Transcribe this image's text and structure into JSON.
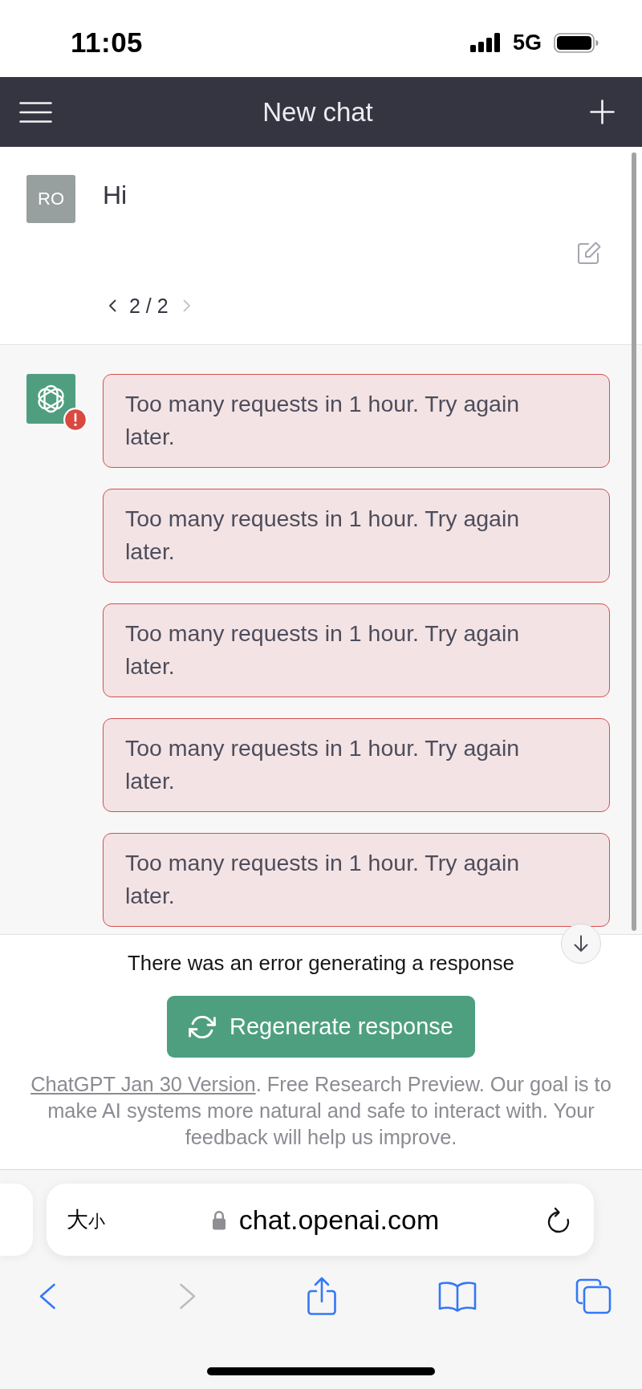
{
  "status_bar": {
    "time": "11:05",
    "network": "5G"
  },
  "header": {
    "title": "New chat"
  },
  "user_message": {
    "avatar": "RO",
    "text": "Hi",
    "pager": {
      "label": "2 / 2",
      "prev_disabled": false,
      "next_disabled": true
    }
  },
  "assistant": {
    "error": true,
    "messages": [
      {
        "text": "Too many requests in 1 hour. Try again later.",
        "error": true
      },
      {
        "text": "Too many requests in 1 hour. Try again later.",
        "error": true
      },
      {
        "text": "Too many requests in 1 hour. Try again later.",
        "error": true
      },
      {
        "text": "Too many requests in 1 hour. Try again later.",
        "error": true
      },
      {
        "text": "Too many requests in 1 hour. Try again later.",
        "error": true
      }
    ]
  },
  "error_notice": "There was an error generating a response",
  "regenerate_button": {
    "label": "Regenerate response"
  },
  "footer": {
    "link": "ChatGPT Jan 30 Version",
    "text": ". Free Research Preview. Our goal is to make AI systems more natural and safe to interact with. Your feedback will help us improve."
  },
  "browser": {
    "text_size": [
      "大",
      "小"
    ],
    "url": "chat.openai.com",
    "back_disabled": false,
    "forward_disabled": true
  }
}
